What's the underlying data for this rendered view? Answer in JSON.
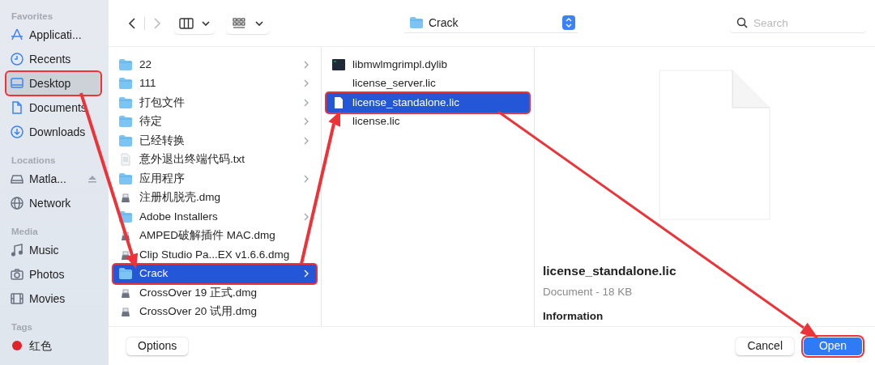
{
  "sidebar": {
    "sections": [
      {
        "title": "Favorites",
        "items": [
          {
            "label": "Applicati...",
            "selected": false,
            "highlighted": false
          },
          {
            "label": "Recents",
            "selected": false,
            "highlighted": false
          },
          {
            "label": "Desktop",
            "selected": true,
            "highlighted": true
          },
          {
            "label": "Documents",
            "selected": false,
            "highlighted": false
          },
          {
            "label": "Downloads",
            "selected": false,
            "highlighted": false
          }
        ]
      },
      {
        "title": "Locations",
        "items": [
          {
            "label": "Matla...",
            "selected": false,
            "highlighted": false
          },
          {
            "label": "Network",
            "selected": false,
            "highlighted": false
          }
        ]
      },
      {
        "title": "Media",
        "items": [
          {
            "label": "Music",
            "selected": false,
            "highlighted": false
          },
          {
            "label": "Photos",
            "selected": false,
            "highlighted": false
          },
          {
            "label": "Movies",
            "selected": false,
            "highlighted": false
          }
        ]
      },
      {
        "title": "Tags",
        "items": [
          {
            "label": "红色",
            "color": "#e0242a",
            "selected": false,
            "highlighted": false
          }
        ]
      }
    ]
  },
  "toolbar": {
    "path": "Crack",
    "search": {
      "placeholder": "Search"
    }
  },
  "columns": [
    [
      {
        "name": "22",
        "kind": "folder",
        "selected": false,
        "highlighted": false
      },
      {
        "name": "111",
        "kind": "folder",
        "selected": false,
        "highlighted": false
      },
      {
        "name": "打包文件",
        "kind": "folder",
        "selected": false,
        "highlighted": false
      },
      {
        "name": "待定",
        "kind": "folder",
        "selected": false,
        "highlighted": false
      },
      {
        "name": "已经转换",
        "kind": "folder",
        "selected": false,
        "highlighted": false
      },
      {
        "name": "意外退出终端代码.txt",
        "kind": "text",
        "selected": false,
        "highlighted": false
      },
      {
        "name": "应用程序",
        "kind": "folder",
        "selected": false,
        "highlighted": false
      },
      {
        "name": "注册机脱壳.dmg",
        "kind": "disk",
        "selected": false,
        "highlighted": false
      },
      {
        "name": "Adobe Installers",
        "kind": "folder",
        "selected": false,
        "highlighted": false
      },
      {
        "name": "AMPED破解插件 MAC.dmg",
        "kind": "disk",
        "selected": false,
        "highlighted": false
      },
      {
        "name": "Clip Studio Pa...EX v1.6.6.dmg",
        "kind": "disk",
        "selected": false,
        "highlighted": false
      },
      {
        "name": "Crack",
        "kind": "folder",
        "selected": true,
        "highlighted": true
      },
      {
        "name": "CrossOver 19 正式.dmg",
        "kind": "disk",
        "selected": false,
        "highlighted": false
      },
      {
        "name": "CrossOver 20 试用.dmg",
        "kind": "disk",
        "selected": false,
        "highlighted": false
      }
    ],
    [
      {
        "name": "libmwlmgrimpl.dylib",
        "kind": "exec",
        "selected": false,
        "highlighted": false
      },
      {
        "name": "license_server.lic",
        "kind": "blank",
        "selected": false,
        "highlighted": false
      },
      {
        "name": "license_standalone.lic",
        "kind": "document",
        "selected": true,
        "highlighted": true
      },
      {
        "name": "license.lic",
        "kind": "blank",
        "selected": false,
        "highlighted": false
      }
    ]
  ],
  "preview": {
    "name": "license_standalone.lic",
    "meta": "Document - 18 KB",
    "section": "Information"
  },
  "buttons": [
    {
      "label": "Options",
      "kind": "plain",
      "highlighted": false
    },
    {
      "label": "Cancel",
      "kind": "plain",
      "highlighted": false
    },
    {
      "label": "Open",
      "kind": "default",
      "highlighted": true
    }
  ]
}
